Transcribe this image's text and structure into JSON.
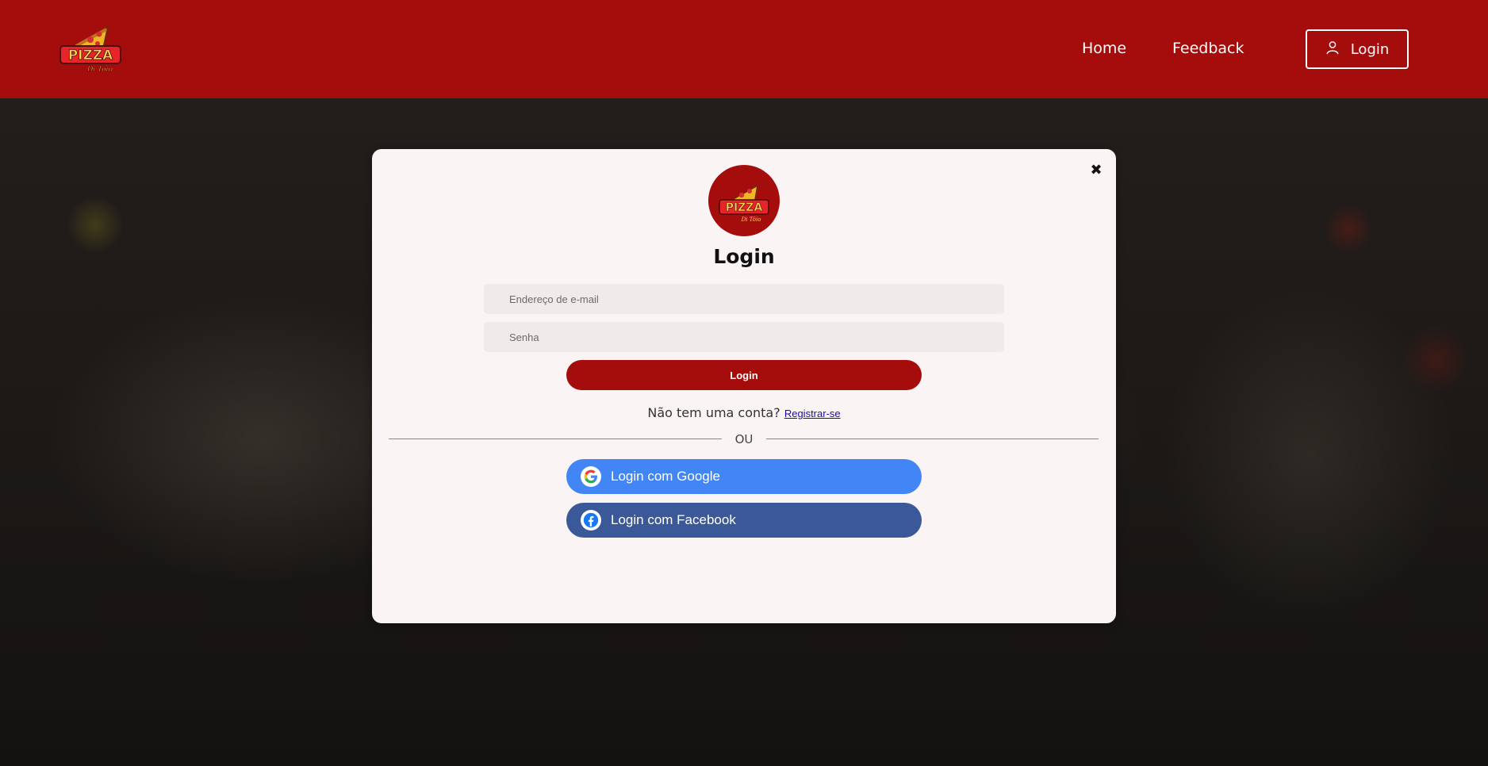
{
  "header": {
    "logo_alt": "Pizza Di Tôio",
    "nav": {
      "home": "Home",
      "feedback": "Feedback"
    },
    "login_button": "Login"
  },
  "modal": {
    "close_symbol": "✖",
    "title": "Login",
    "email_placeholder": "Endereço de e-mail",
    "password_placeholder": "Senha",
    "submit_label": "Login",
    "no_account_text": "Não tem uma conta?",
    "register_link": "Registrar-se",
    "divider_text": "OU",
    "google_label": "Login com Google",
    "facebook_label": "Login com Facebook"
  },
  "colors": {
    "brand_red": "#a50d0d",
    "google_blue": "#4285f4",
    "facebook_blue": "#3b5998",
    "modal_bg": "#fbf4f4"
  },
  "icons": {
    "header_login": "user-icon",
    "close": "close-icon",
    "google": "google-icon",
    "facebook": "facebook-icon"
  }
}
